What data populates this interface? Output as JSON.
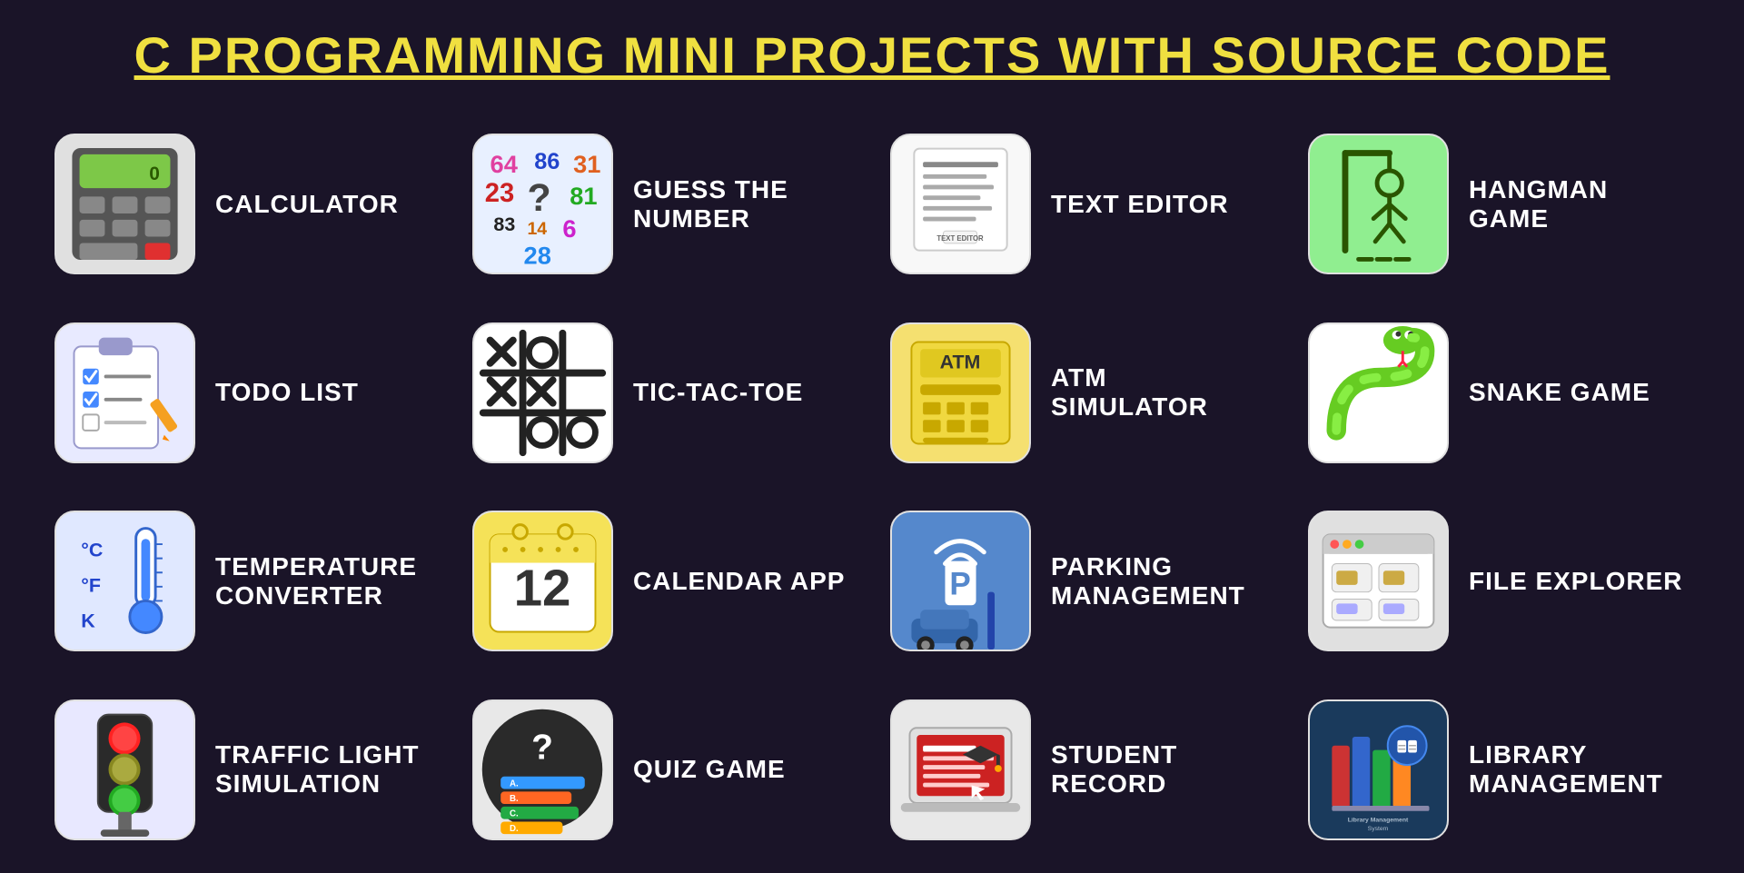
{
  "page": {
    "title": "C PROGRAMMING MINI PROJECTS WITH SOURCE CODE",
    "bg_color": "#1a1428"
  },
  "projects": [
    {
      "id": "calculator",
      "label": "CALCULATOR",
      "icon_type": "calculator"
    },
    {
      "id": "guess-number",
      "label": "GUESS THE NUMBER",
      "icon_type": "guess"
    },
    {
      "id": "text-editor",
      "label": "TEXT EDITOR",
      "icon_type": "texteditor"
    },
    {
      "id": "hangman",
      "label": "HANGMAN GAME",
      "icon_type": "hangman"
    },
    {
      "id": "todo",
      "label": "TODO LIST",
      "icon_type": "todo"
    },
    {
      "id": "tictactoe",
      "label": "TIC-TAC-TOE",
      "icon_type": "tictactoe"
    },
    {
      "id": "atm",
      "label": "ATM SIMULATOR",
      "icon_type": "atm"
    },
    {
      "id": "snake",
      "label": "SNAKE GAME",
      "icon_type": "snake"
    },
    {
      "id": "temp",
      "label": "TEMPERATURE CONVERTER",
      "icon_type": "temperature"
    },
    {
      "id": "calendar",
      "label": "CALENDAR APP",
      "icon_type": "calendar"
    },
    {
      "id": "parking",
      "label": "PARKING MANAGEMENT",
      "icon_type": "parking"
    },
    {
      "id": "fileexplorer",
      "label": "FILE EXPLORER",
      "icon_type": "fileexplorer"
    },
    {
      "id": "traffic",
      "label": "TRAFFIC LIGHT SIMULATION",
      "icon_type": "traffic"
    },
    {
      "id": "quiz",
      "label": "QUIZ GAME",
      "icon_type": "quiz"
    },
    {
      "id": "student",
      "label": "STUDENT RECORD",
      "icon_type": "student"
    },
    {
      "id": "library",
      "label": "LIBRARY MANAGEMENT",
      "icon_type": "library"
    }
  ]
}
